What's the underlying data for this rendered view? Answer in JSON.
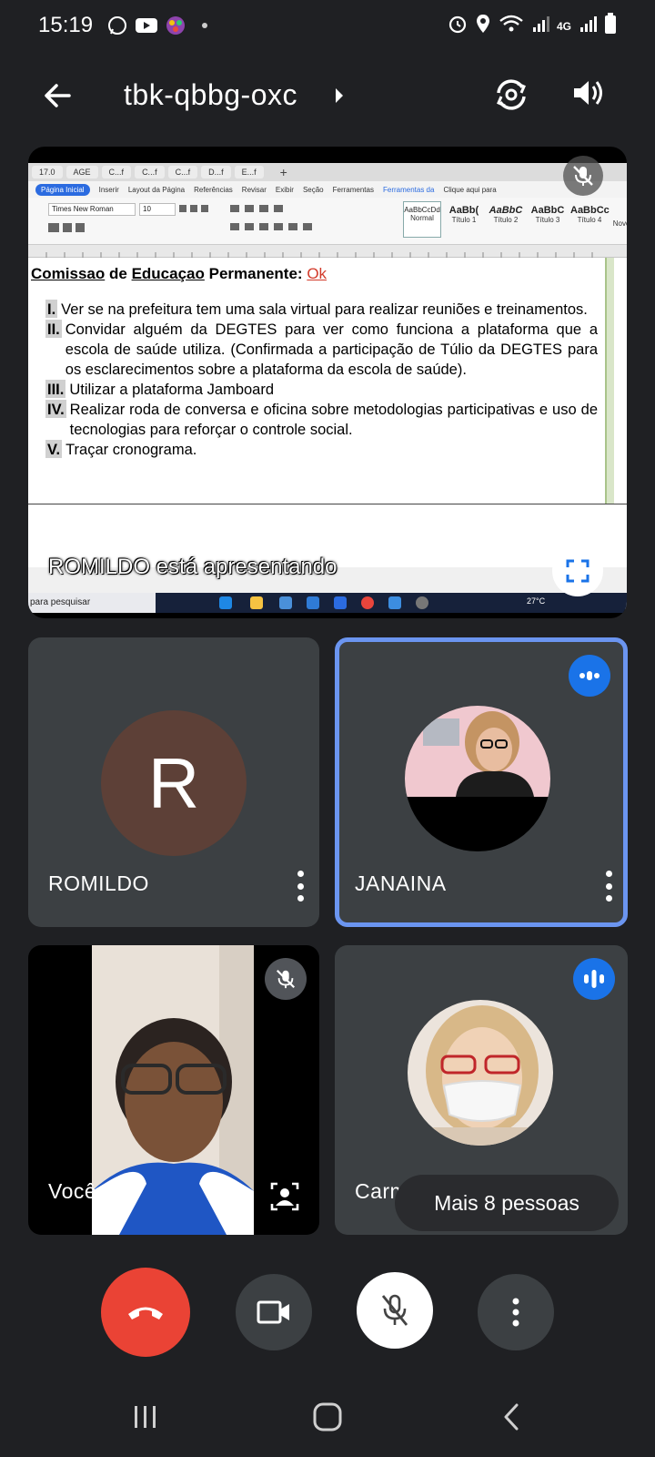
{
  "status_bar": {
    "time": "15:19",
    "network_label": "4G"
  },
  "meeting": {
    "code": "tbk-qbbg-oxc"
  },
  "presentation": {
    "presenting_label": "ROMILDO está apresentando",
    "doc_tabs": [
      "17.0",
      "AGE",
      "C...f",
      "C...f",
      "C...f",
      "D...f",
      "E...f"
    ],
    "ribbon_menu": [
      "Página Inicial",
      "Inserir",
      "Layout da Página",
      "Referências",
      "Revisar",
      "Exibir",
      "Seção",
      "Ferramentas",
      "Ferramentas da"
    ],
    "ribbon_search": "Clique aqui para",
    "font_name": "Times New Roman",
    "font_size": "10",
    "styles": [
      {
        "sample": "AaBbCcDd",
        "label": "Normal"
      },
      {
        "sample": "AaBb(",
        "label": "Título 1"
      },
      {
        "sample": "AaBbC",
        "label": "Título 2"
      },
      {
        "sample": "AaBbC",
        "label": "Título 3"
      },
      {
        "sample": "AaBbCc",
        "label": "Título 4"
      },
      {
        "sample": "",
        "label": "Novo Estilo"
      }
    ],
    "doc_heading_part1": "Comissao",
    "doc_heading_part2": "de",
    "doc_heading_part3": "Educaçao",
    "doc_heading_part4": "Permanente:",
    "doc_heading_ok": "Ok",
    "items": [
      {
        "num": "I.",
        "text": "Ver se na prefeitura tem uma sala virtual para realizar reuniões e treinamentos."
      },
      {
        "num": "II.",
        "text": "Convidar alguém da DEGTES para ver como funciona a plataforma que a escola de saúde utiliza. (Confirmada a participação de Túlio da DEGTES para os esclarecimentos sobre a plataforma da escola de saúde)."
      },
      {
        "num": "III.",
        "text": "Utilizar a plataforma Jamboard"
      },
      {
        "num": "IV.",
        "text": "Realizar roda de conversa e oficina sobre metodologias participativas e uso de tecnologias para reforçar o controle social."
      },
      {
        "num": "V.",
        "text": "Traçar cronograma."
      }
    ],
    "taskbar_search": "para pesquisar",
    "temperature": "27°C"
  },
  "participants": {
    "romildo": {
      "name": "ROMILDO",
      "initial": "R"
    },
    "janaina": {
      "name": "JANAINA"
    },
    "voce": {
      "name": "Você"
    },
    "carmela": {
      "name": "Carm"
    }
  },
  "more_people_label": "Mais 8 pessoas",
  "colors": {
    "background": "#1f2023",
    "tile": "#3c4043",
    "active_speaker_border": "#6b95f0",
    "speaking_badge": "#1a73e8",
    "end_call": "#ea4335",
    "avatar_romildo": "#5d4037"
  }
}
